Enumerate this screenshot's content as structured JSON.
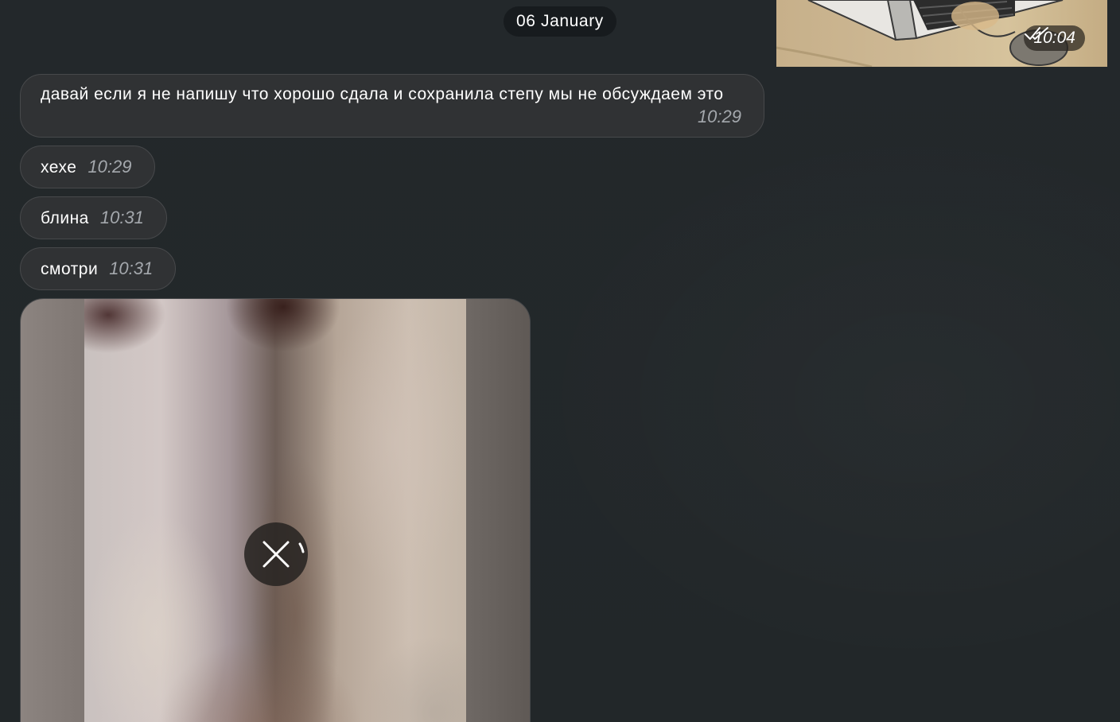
{
  "date_separator": "06 January",
  "outgoing_photo": {
    "time": "10:04",
    "status_icon": "double-check-icon"
  },
  "messages": [
    {
      "text": "давай если я не напишу что хорошо сдала и сохранила степу мы не обсуждаем это",
      "time": "10:29"
    },
    {
      "text": "хехе",
      "time": "10:29"
    },
    {
      "text": "блина",
      "time": "10:31"
    },
    {
      "text": "смотри",
      "time": "10:31"
    }
  ],
  "media_message": {
    "state_icon": "cancel-download-icon",
    "progress_icon": "loading-arc-icon"
  }
}
